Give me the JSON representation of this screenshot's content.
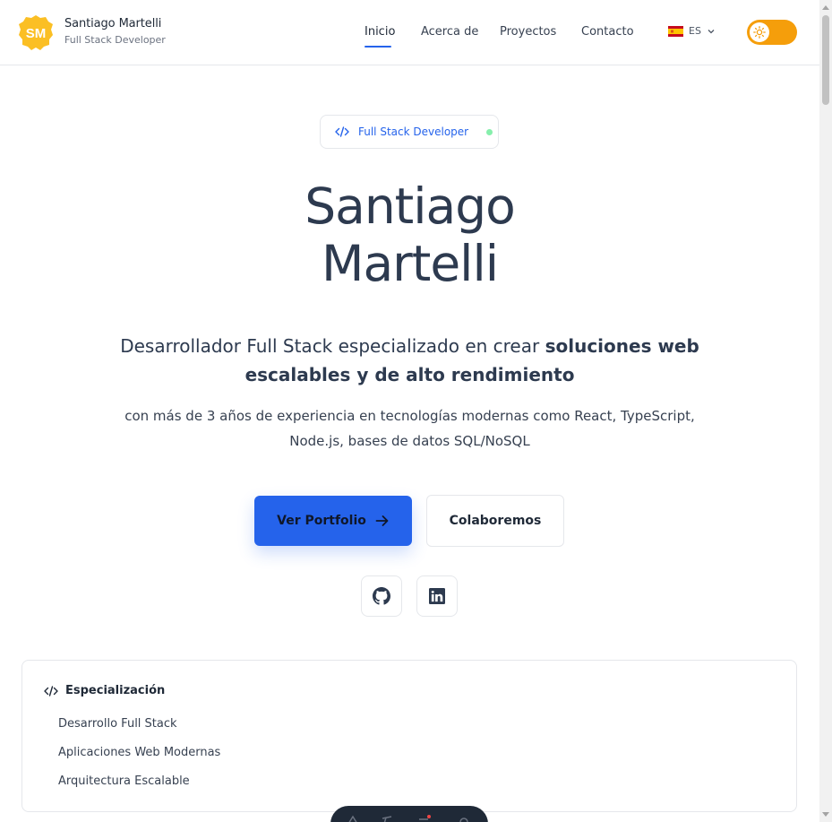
{
  "header": {
    "logo_initials": "SM",
    "name": "Santiago Martelli",
    "role": "Full Stack Developer",
    "nav": [
      {
        "label": "Inicio",
        "active": true
      },
      {
        "label": "Acerca de",
        "active": false
      },
      {
        "label": "Proyectos",
        "active": false
      },
      {
        "label": "Contacto",
        "active": false
      }
    ],
    "language": {
      "code": "ES",
      "flag_icon": "spain-flag-icon"
    },
    "theme_toggle": {
      "icon": "sun-icon",
      "color": "#f59e0b"
    }
  },
  "hero": {
    "badge": {
      "icon": "code-icon",
      "label": "Full Stack Developer",
      "dot_color": "#86efac"
    },
    "name_line1": "Santiago",
    "name_line2": "Martelli",
    "tagline_plain": "Desarrollador Full Stack especializado en crear ",
    "tagline_bold": "soluciones web escalables y de alto rendimiento",
    "subline": "con más de 3 años de experiencia en tecnologías modernas como React, TypeScript, Node.js, bases de datos SQL/NoSQL",
    "primary_button": {
      "label": "Ver Portfolio",
      "icon": "arrow-right-icon",
      "color": "#2563eb"
    },
    "secondary_button": {
      "label": "Colaboremos"
    },
    "social": [
      {
        "name": "github-icon"
      },
      {
        "name": "linkedin-icon"
      }
    ]
  },
  "specialization": {
    "icon": "code-icon",
    "title": "Especialización",
    "items": [
      "Desarrollo Full Stack",
      "Aplicaciones Web Modernas",
      "Arquitectura Escalable"
    ]
  },
  "colors": {
    "accent": "#2563eb",
    "text": "#2d3a4f",
    "logo": "#fbbf24"
  }
}
